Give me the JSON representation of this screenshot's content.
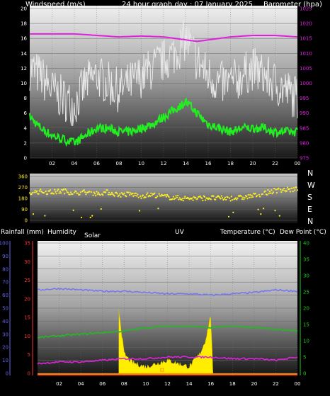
{
  "header": {
    "wind_label": "Windspeed (m/s)",
    "date_label": "24 hour graph day : 07 January 2025",
    "baro_label": "Barometer (hpa)"
  },
  "mid_header": {
    "rain_label": "Rainfall (mm)",
    "humidity_label": "Humidity",
    "solar_label": "Solar",
    "uv_label": "UV",
    "temp_label": "Temperature (°C)",
    "dew_label": "Dew Point (°C)"
  },
  "x_ticks": [
    "02",
    "04",
    "06",
    "08",
    "10",
    "12",
    "14",
    "16",
    "18",
    "20",
    "22",
    "00"
  ],
  "direction_labels": [
    "N",
    "W",
    "S",
    "E",
    "N"
  ],
  "colors": {
    "wind_gust": "#e8e8e8",
    "wind_avg": "#22ee22",
    "barometer": "#e020e0",
    "direction": "#ffee22",
    "humidity": "#7777ee",
    "temperature": "#22bb22",
    "dew_point": "#dd22dd",
    "solar": "#ffee00",
    "rain": "#ff2222",
    "uv": "#ff8800"
  },
  "chart_data": [
    {
      "type": "line",
      "x_label": "hour",
      "x_ticks": [
        "02",
        "04",
        "06",
        "08",
        "10",
        "12",
        "14",
        "16",
        "18",
        "20",
        "22",
        "00"
      ],
      "y_ticks_left": [
        0,
        2,
        4,
        6,
        8,
        10,
        12,
        14,
        16,
        18,
        20
      ],
      "y_ticks_right": [
        975,
        980,
        985,
        990,
        995,
        1000,
        1005,
        1010,
        1015,
        1020,
        1025
      ],
      "ylim_left": [
        0,
        20
      ],
      "ylim_right": [
        975,
        1025
      ],
      "series": [
        {
          "name": "Windspeed (m/s)",
          "role": "gust",
          "axis": "left",
          "x": [
            0,
            1,
            2,
            3,
            4,
            5,
            6,
            7,
            8,
            9,
            10,
            11,
            12,
            13,
            14,
            15,
            16,
            17,
            18,
            19,
            20,
            21,
            22,
            23,
            24
          ],
          "values": [
            12,
            11,
            9,
            8,
            7,
            10,
            11,
            10,
            9,
            10,
            11,
            12,
            13,
            14,
            16,
            13,
            11,
            10,
            10,
            11,
            12,
            11,
            10,
            9,
            8
          ]
        },
        {
          "name": "Windspeed (m/s)",
          "role": "average",
          "axis": "left",
          "x": [
            0,
            1,
            2,
            3,
            4,
            5,
            6,
            7,
            8,
            9,
            10,
            11,
            12,
            13,
            14,
            15,
            16,
            17,
            18,
            19,
            20,
            21,
            22,
            23,
            24
          ],
          "values": [
            5.5,
            4,
            3,
            2.5,
            2,
            3,
            4,
            4,
            3.5,
            3.5,
            4,
            4.5,
            5.5,
            6.5,
            7.5,
            6,
            4.5,
            4,
            3.5,
            4,
            4,
            4,
            3.5,
            3.5,
            3.5
          ]
        },
        {
          "name": "Barometer (hpa)",
          "axis": "right",
          "x": [
            0,
            2,
            4,
            6,
            8,
            10,
            12,
            14,
            15,
            16,
            18,
            20,
            22,
            24
          ],
          "values": [
            1016.5,
            1016.5,
            1016.5,
            1016,
            1015.5,
            1015.8,
            1015.5,
            1014.5,
            1014,
            1014.5,
            1015.5,
            1016,
            1016,
            1015.5
          ]
        }
      ]
    },
    {
      "type": "scatter",
      "x_ticks": [
        "02",
        "04",
        "06",
        "08",
        "10",
        "12",
        "14",
        "16",
        "18",
        "20",
        "22",
        "00"
      ],
      "y_ticks": [
        0,
        90,
        180,
        270,
        360
      ],
      "ylim": [
        0,
        360
      ],
      "series": [
        {
          "name": "Wind direction",
          "x": [
            0,
            1,
            2,
            3,
            4,
            5,
            6,
            7,
            8,
            9,
            10,
            11,
            12,
            13,
            14,
            15,
            16,
            17,
            18,
            19,
            20,
            21,
            22,
            23,
            24
          ],
          "values": [
            230,
            235,
            230,
            240,
            225,
            230,
            220,
            230,
            210,
            215,
            200,
            210,
            195,
            185,
            180,
            180,
            185,
            180,
            180,
            185,
            200,
            220,
            245,
            250,
            255
          ]
        }
      ]
    },
    {
      "type": "area",
      "x_ticks": [
        "02",
        "04",
        "06",
        "08",
        "10",
        "12",
        "14",
        "16",
        "18",
        "20",
        "22",
        "00"
      ],
      "y_ticks_left_humidity": [
        0,
        10,
        20,
        30,
        40,
        50,
        60,
        70,
        80,
        90,
        100
      ],
      "y_ticks_left_rain": [
        0,
        5,
        10,
        15,
        20,
        25,
        30,
        35
      ],
      "y_ticks_right": [
        0,
        5,
        10,
        15,
        20,
        25,
        30,
        35,
        40
      ],
      "ylim_humidity": [
        0,
        100
      ],
      "ylim_rain": [
        0,
        35
      ],
      "ylim_right": [
        0,
        40
      ],
      "series": [
        {
          "name": "Humidity",
          "axis": "left",
          "x": [
            0,
            2,
            4,
            6,
            8,
            10,
            12,
            14,
            16,
            18,
            20,
            22,
            24
          ],
          "values": [
            64,
            65,
            64,
            63,
            63,
            62,
            61,
            61,
            60,
            61,
            62,
            64,
            63
          ]
        },
        {
          "name": "Temperature (°C)",
          "axis": "right",
          "x": [
            0,
            2,
            4,
            6,
            8,
            10,
            12,
            14,
            16,
            18,
            20,
            22,
            24
          ],
          "values": [
            11,
            11.5,
            12,
            12.5,
            13,
            14,
            14.5,
            14.5,
            14,
            14.5,
            14,
            13.5,
            13
          ]
        },
        {
          "name": "Dew Point (°C)",
          "axis": "right",
          "x": [
            0,
            2,
            4,
            6,
            8,
            10,
            12,
            14,
            16,
            18,
            20,
            22,
            24
          ],
          "values": [
            3,
            3.5,
            3.5,
            4,
            4.5,
            4.5,
            5,
            5,
            5,
            4.5,
            4.5,
            4,
            5
          ]
        },
        {
          "name": "Solar",
          "axis": "right",
          "x": [
            7.5,
            8,
            8.5,
            9,
            10,
            11,
            12,
            13,
            14,
            15,
            15.5,
            16,
            16.2
          ],
          "values": [
            20,
            6,
            4,
            3,
            2,
            3,
            4,
            3,
            2,
            6,
            10,
            18,
            0
          ]
        },
        {
          "name": "Rainfall (mm)",
          "axis": "left",
          "values": [
            0,
            0,
            0,
            0,
            0,
            0,
            0,
            0,
            0,
            0,
            0,
            0,
            0
          ]
        },
        {
          "name": "UV",
          "axis": "right",
          "values": [
            0,
            0,
            0,
            0,
            0,
            0,
            0,
            0,
            0,
            0,
            0,
            0,
            0
          ]
        }
      ]
    }
  ]
}
